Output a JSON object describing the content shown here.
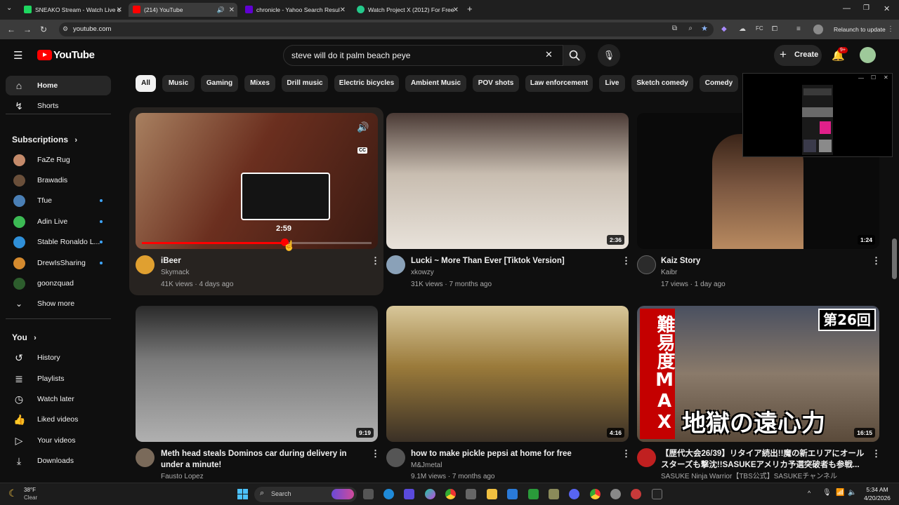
{
  "browser": {
    "tabs": [
      {
        "title": "SNEAKO Stream - Watch Live o",
        "color": "#1ed760"
      },
      {
        "title": "(214) YouTube",
        "color": "#ff0000"
      },
      {
        "title": "chronicle - Yahoo Search Resul",
        "color": "#6001d2"
      },
      {
        "title": "Watch Project X (2012) For Free",
        "color": "#24c98b"
      }
    ],
    "url": "youtube.com",
    "relaunch": "Relaunch to update"
  },
  "youtube": {
    "logo": "YouTube",
    "search_value": "steve will do it palm beach peye",
    "create_label": "Create",
    "notif_badge": "9+"
  },
  "sidebar": {
    "main": [
      {
        "label": "Home",
        "icon": "home-icon"
      },
      {
        "label": "Shorts",
        "icon": "shorts-icon"
      }
    ],
    "subscriptions_title": "Subscriptions",
    "subscriptions": [
      {
        "label": "FaZe Rug",
        "color": "#c48a6a",
        "live": false
      },
      {
        "label": "Brawadis",
        "color": "#6a4f3a",
        "live": false
      },
      {
        "label": "Tfue",
        "color": "#4a7fb5",
        "live": true
      },
      {
        "label": "Adin Live",
        "color": "#3cba54",
        "live": true
      },
      {
        "label": "Stable Ronaldo L...",
        "color": "#2f8fd8",
        "live": true
      },
      {
        "label": "DrewIsSharing",
        "color": "#d48a2e",
        "live": true
      },
      {
        "label": "goonzquad",
        "color": "#2d5d2d",
        "live": false
      }
    ],
    "show_more": "Show more",
    "you_title": "You",
    "you_items": [
      {
        "label": "History",
        "icon": "history-icon"
      },
      {
        "label": "Playlists",
        "icon": "playlists-icon"
      },
      {
        "label": "Watch later",
        "icon": "watch-later-icon"
      },
      {
        "label": "Liked videos",
        "icon": "liked-videos-icon"
      },
      {
        "label": "Your videos",
        "icon": "your-videos-icon"
      },
      {
        "label": "Downloads",
        "icon": "downloads-icon"
      }
    ]
  },
  "chips": [
    "All",
    "Music",
    "Gaming",
    "Mixes",
    "Drill music",
    "Electric bicycles",
    "Ambient Music",
    "POV shots",
    "Law enforcement",
    "Live",
    "Sketch comedy",
    "Comedy"
  ],
  "videos": [
    {
      "title": "iBeer",
      "channel": "Skymack",
      "meta": "41K views · 4 days ago",
      "duration": "",
      "hover_time": "2:59",
      "thumb": "#6b2f1f",
      "ava": "#e0a030",
      "progress": 0.62
    },
    {
      "title": "Lucki ~ More Than Ever [Tiktok Version]",
      "channel": "xkowzy",
      "meta": "31K views · 7 months ago",
      "duration": "2:36",
      "thumb": "#8c7f72",
      "ava": "#8aa1b8"
    },
    {
      "title": "Kaiz Story",
      "channel": "Kaibr",
      "meta": "17 views · 1 day ago",
      "duration": "1:24",
      "thumb": "#1a1a1a",
      "ava": "#2b2b2b"
    },
    {
      "title": "Meth head steals Dominos car during delivery in under a minute!",
      "channel": "Fausto Lopez",
      "meta": "",
      "duration": "9:19",
      "thumb": "#5a5a5a",
      "ava": "#7a6a5a"
    },
    {
      "title": "how to make pickle  pepsi at home  for free",
      "channel": "M&Jmetal",
      "meta": "9.1M views · 7 months ago",
      "duration": "4:16",
      "thumb": "#9a7a3a",
      "ava": "#555"
    },
    {
      "title": "【歴代大会26/39】リタイア続出!!魔の新エリアにオールスターズも撃沈!!SASUKEアメリカ予選突破者も参戦...",
      "channel": "SASUKE Ninja Warrior【TBS公式】SASUKEチャンネル",
      "meta": "",
      "duration": "16:15",
      "thumb": "#6a5a4a",
      "ava": "#c02020",
      "badge": "第26回",
      "side": "難易度MAX",
      "overlay": "地獄の遠心力"
    }
  ],
  "taskbar": {
    "weather_temp": "38°F",
    "weather_desc": "Clear",
    "search": "Search",
    "time": "5:34 AM",
    "date": "4/20/2026"
  }
}
